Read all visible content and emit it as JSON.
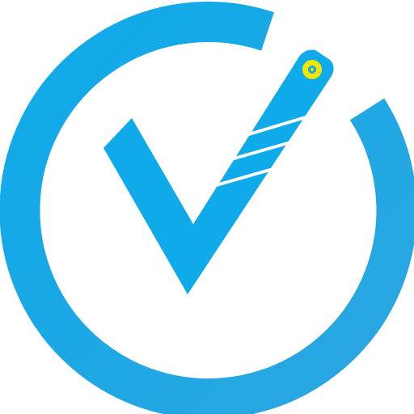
{
  "logo": {
    "icon": "checkmark-pen-circle-icon",
    "colors": {
      "ring": "#2BA6E0",
      "check": "#0EAAEA",
      "pen_stripes": "#FFFFFF",
      "pen_tip_outer": "#F2E500",
      "pen_tip_inner": "#0EAAEA",
      "background": "#FFFFFF"
    }
  }
}
